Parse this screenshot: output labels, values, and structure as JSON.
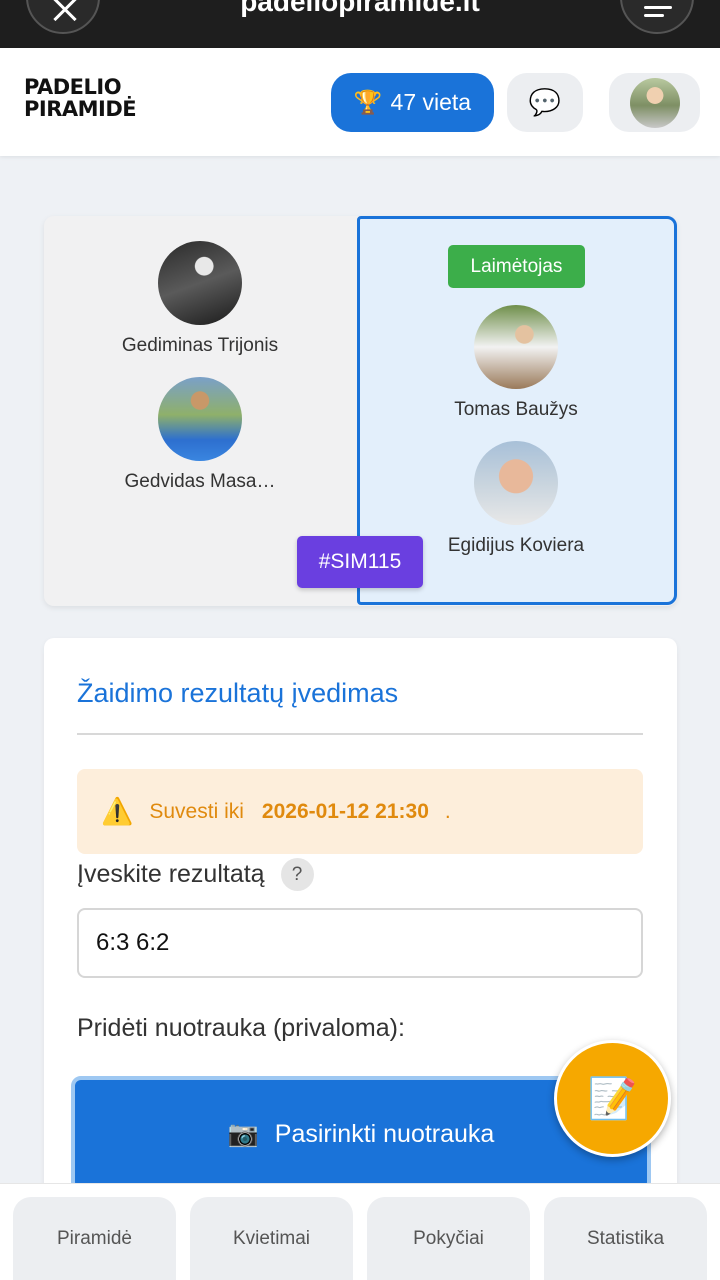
{
  "browser": {
    "url": "padeliopiramide.lt"
  },
  "header": {
    "logo_line1": "PADELIO",
    "logo_line2": "PIRAMIDĖ",
    "rank_icon": "trophy-icon",
    "rank_label": "47 vieta",
    "chat_icon": "speech-bubble-icon"
  },
  "match": {
    "team_left": [
      {
        "name": "Gediminas Trijonis"
      },
      {
        "name": "Gedvidas Masa…"
      }
    ],
    "team_right": [
      {
        "name": "Tomas Baužys"
      },
      {
        "name": "Egidijus Koviera"
      }
    ],
    "winner_label": "Laimėtojas",
    "match_id": "#SIM115"
  },
  "result_entry": {
    "title": "Žaidimo rezultatų įvedimas",
    "deadline_prefix": "Suvesti iki",
    "deadline_date": "2026-01-12 21:30",
    "deadline_suffix": ".",
    "input_label": "Įveskite rezultatą",
    "help_label": "?",
    "score_value": "6:3 6:2",
    "photo_label": "Pridėti nuotrauka (privaloma):",
    "photo_button_icon": "📷",
    "photo_button_label": "Pasirinkti nuotrauka",
    "fab_icon": "📝"
  },
  "bottom_nav": [
    {
      "label": "Piramidė"
    },
    {
      "label": "Kvietimai"
    },
    {
      "label": "Pokyčiai"
    },
    {
      "label": "Statistika"
    }
  ],
  "colors": {
    "primary": "#1a73d9",
    "winner_green": "#3cae4a",
    "match_id_purple": "#6a3fe0",
    "warning_orange": "#e08a0e",
    "fab_orange": "#f6a800"
  }
}
